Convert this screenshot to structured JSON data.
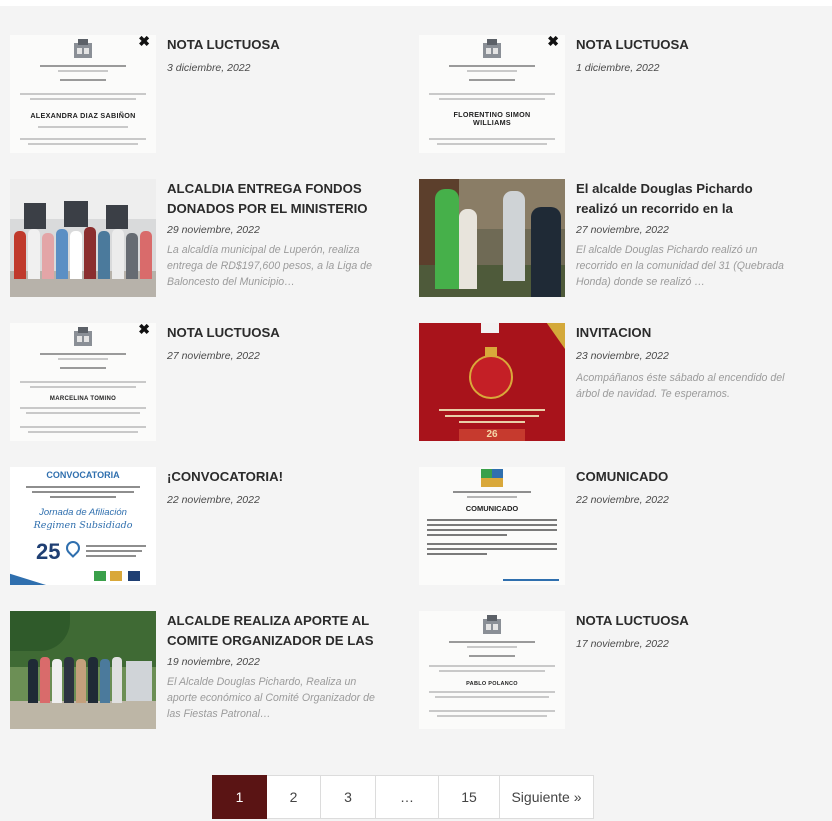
{
  "posts": [
    {
      "title": "NOTA LUCTUOSA",
      "date": "3 diciembre, 2022",
      "excerpt": "",
      "thumb": {
        "kind": "nota",
        "name": "ALEXANDRA DIAZ SABIÑON"
      }
    },
    {
      "title": "NOTA LUCTUOSA",
      "date": "1 diciembre, 2022",
      "excerpt": "",
      "thumb": {
        "kind": "nota",
        "name": "FLORENTINO SIMON WILLIAMS"
      }
    },
    {
      "title": "ALCALDIA ENTREGA FONDOS DONADOS POR EL MINISTERIO",
      "date": "29 noviembre, 2022",
      "excerpt": "La alcaldía municipal de Luperón, realiza entrega de RD$197,600 pesos, a la Liga de Baloncesto del Municipio…",
      "thumb": {
        "kind": "photo-group-indoor"
      }
    },
    {
      "title": "El alcalde Douglas Pichardo realizó un recorrido en la",
      "date": "27 noviembre, 2022",
      "excerpt": "El alcalde Douglas Pichardo realizó un recorrido en la comunidad del 31 (Quebrada Honda) donde se realizó …",
      "thumb": {
        "kind": "photo-outdoor"
      }
    },
    {
      "title": "NOTA LUCTUOSA",
      "date": "27 noviembre, 2022",
      "excerpt": "",
      "thumb": {
        "kind": "nota",
        "name": "MARCELINA TOMINO"
      }
    },
    {
      "title": "INVITACION",
      "date": "23 noviembre, 2022",
      "excerpt": "Acompáñanos éste sábado al encendido del árbol de navidad. Te esperamos.",
      "thumb": {
        "kind": "christmas",
        "day": "26"
      }
    },
    {
      "title": "¡CONVOCATORIA!",
      "date": "22 noviembre, 2022",
      "excerpt": "",
      "thumb": {
        "kind": "convocatoria",
        "heading": "CONVOCATORIA",
        "line1": "Jornada de Afiliación",
        "line2": "Regimen Subsidiado",
        "day": "25"
      }
    },
    {
      "title": "COMUNICADO",
      "date": "22 noviembre, 2022",
      "excerpt": "",
      "thumb": {
        "kind": "comunicado",
        "heading": "COMUNICADO"
      }
    },
    {
      "title": "ALCALDE REALIZA APORTE AL COMITE ORGANIZADOR DE LAS",
      "date": "19 noviembre, 2022",
      "excerpt": "El Alcalde Douglas Pichardo, Realiza un aporte económico al Comité Organizador de las Fiestas Patronal…",
      "thumb": {
        "kind": "photo-group-outdoor"
      }
    },
    {
      "title": "NOTA LUCTUOSA",
      "date": "17 noviembre, 2022",
      "excerpt": "",
      "thumb": {
        "kind": "nota",
        "name": "PABLO POLANCO"
      }
    }
  ],
  "pagination": {
    "items": [
      "1",
      "2",
      "3",
      "…",
      "15",
      "Siguiente »"
    ],
    "current": "1"
  },
  "colors": {
    "accent": "#5a1414",
    "title": "#2b2b2b",
    "excerpt": "#9b9b9b"
  }
}
